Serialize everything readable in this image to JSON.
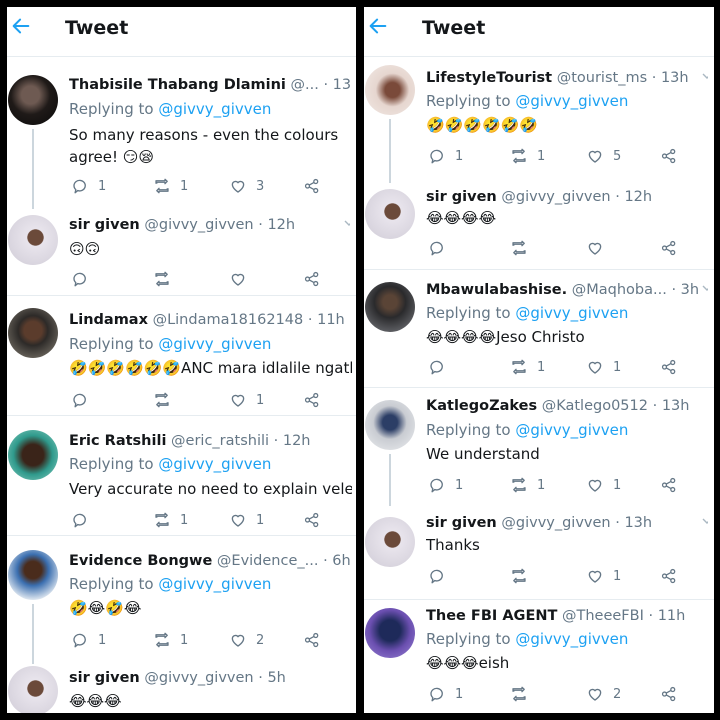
{
  "colors": {
    "accent": "#1da1f2",
    "muted": "#657786",
    "text": "#14171a",
    "divider": "#e6ecf0"
  },
  "header": {
    "title": "Tweet"
  },
  "left_panel": {
    "tweets": [
      {
        "name": "Thabisile Thabang Dlamini",
        "handle": "@...",
        "time": "13h",
        "reply_prefix": "Replying to",
        "reply_to": "@givvy_givven",
        "text": "So many reasons - even the colours agree! 😏😪",
        "replies": "1",
        "retweets": "1",
        "likes": "3"
      },
      {
        "name": "sir given",
        "handle": "@givvy_givven",
        "time": "12h",
        "text": "🙃🙃",
        "replies": "",
        "retweets": "",
        "likes": ""
      },
      {
        "name": "Lindamax",
        "handle": "@Lindama18162148",
        "time": "11h",
        "reply_prefix": "Replying to",
        "reply_to": "@givvy_givven",
        "text": "🤣🤣🤣🤣🤣🤣ANC mara idlalile ngath",
        "replies": "",
        "retweets": "",
        "likes": "1"
      },
      {
        "name": "Eric Ratshili",
        "handle": "@eric_ratshili",
        "time": "12h",
        "reply_prefix": "Replying to",
        "reply_to": "@givvy_givven",
        "text": "Very accurate no need to explain vele",
        "replies": "",
        "retweets": "1",
        "likes": "1"
      },
      {
        "name": "Evidence Bongwe",
        "handle": "@Evidence_...",
        "time": "6h",
        "reply_prefix": "Replying to",
        "reply_to": "@givvy_givven",
        "text": "🤣😂🤣😂",
        "replies": "1",
        "retweets": "1",
        "likes": "2"
      },
      {
        "name": "sir given",
        "handle": "@givvy_givven",
        "time": "5h",
        "text": "😂😂😂"
      }
    ]
  },
  "right_panel": {
    "tweets": [
      {
        "name": "LifestyleTourist",
        "handle": "@tourist_ms",
        "time": "13h",
        "reply_prefix": "Replying to",
        "reply_to": "@givvy_givven",
        "text": "🤣🤣🤣🤣🤣🤣",
        "replies": "1",
        "retweets": "1",
        "likes": "5"
      },
      {
        "name": "sir given",
        "handle": "@givvy_givven",
        "time": "12h",
        "text": "😂😂😂😂",
        "replies": "",
        "retweets": "",
        "likes": ""
      },
      {
        "name": "Mbawulabashise.",
        "handle": "@Maqhoba...",
        "time": "3h",
        "reply_prefix": "Replying to",
        "reply_to": "@givvy_givven",
        "text": "😂😂😂😂Jeso Christo",
        "replies": "",
        "retweets": "1",
        "likes": "1"
      },
      {
        "name": "KatlegoZakes",
        "handle": "@Katlego0512",
        "time": "13h",
        "reply_prefix": "Replying to",
        "reply_to": "@givvy_givven",
        "text": "We understand",
        "replies": "1",
        "retweets": "1",
        "likes": "1"
      },
      {
        "name": "sir given",
        "handle": "@givvy_givven",
        "time": "13h",
        "text": "Thanks",
        "replies": "",
        "retweets": "",
        "likes": "1"
      },
      {
        "name": "Thee FBI AGENT",
        "handle": "@TheeeFBI",
        "time": "11h",
        "reply_prefix": "Replying to",
        "reply_to": "@givvy_givven",
        "text": "😂😂😂eish",
        "replies": "1",
        "retweets": "",
        "likes": "2"
      }
    ]
  },
  "icons": {
    "back": "arrow-left-icon",
    "reply": "reply-icon",
    "retweet": "retweet-icon",
    "like": "heart-icon",
    "share": "share-icon",
    "more": "chevron-down-icon"
  }
}
